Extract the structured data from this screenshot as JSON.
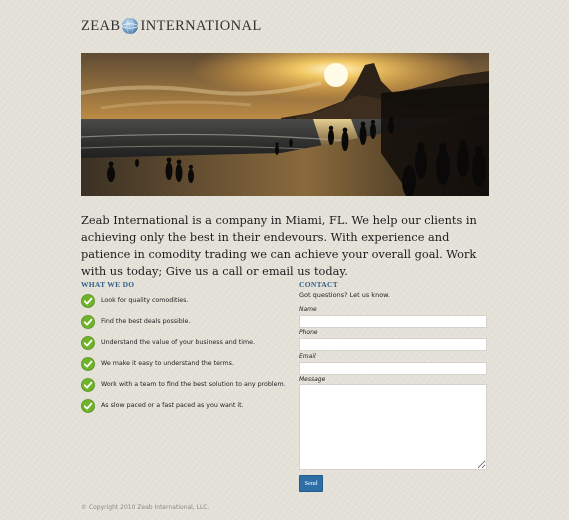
{
  "header": {
    "logo_word_1": "ZEAB",
    "logo_word_2": "INTERNATIONAL",
    "logo_icon": "globe-icon"
  },
  "hero": {
    "image": "sunset-beach-silhouettes"
  },
  "intro": {
    "text": "Zeab International is a company in Miami, FL. We help our clients in achieving only the best in their endevours. With experience and patience in comodity trading we can achieve your overall goal. Work with us today; Give us a call or email us today."
  },
  "what_we_do": {
    "title": "WHAT WE DO",
    "icon": "green-check-icon",
    "items": [
      "Look for quality comodities.",
      "Find the best deals possible.",
      "Understand the value of your business and time.",
      "We make it easy to understand the terms.",
      "Work with a team to find the best solution to any problem.",
      "As slow paced or a fast paced as you want it."
    ]
  },
  "contact": {
    "title": "CONTACT",
    "intro": "Got questions? Let us know.",
    "fields": {
      "name": {
        "label": "Name",
        "value": ""
      },
      "phone": {
        "label": "Phone",
        "value": ""
      },
      "email": {
        "label": "Email",
        "value": ""
      },
      "message": {
        "label": "Message",
        "value": ""
      }
    },
    "send_label": "Send"
  },
  "footer": {
    "copyright": "© Copyright 2010 Zeab International, LLC."
  },
  "colors": {
    "accent": "#2f5f8a",
    "button": "#2e6ea6",
    "check": "#6fb32a",
    "background": "#e4e1d8"
  }
}
